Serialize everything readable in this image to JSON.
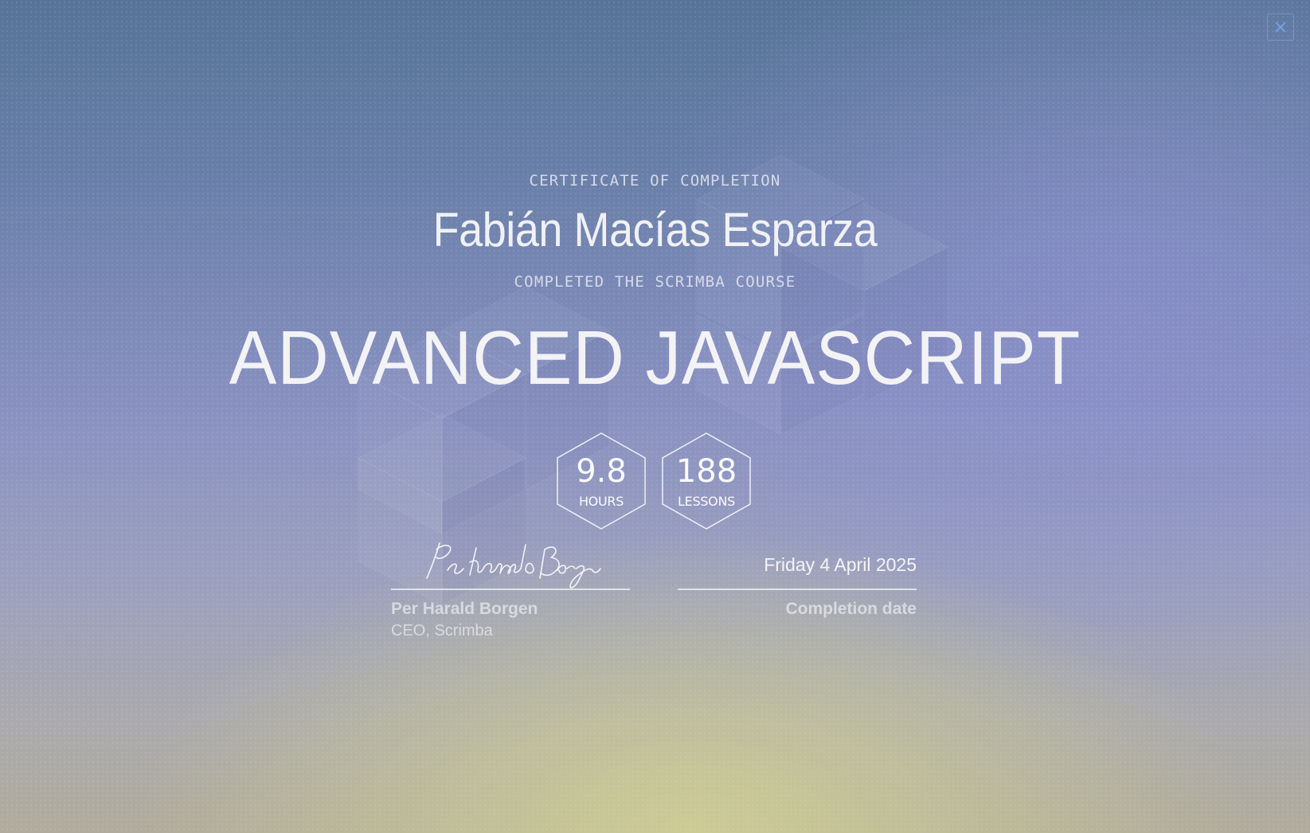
{
  "certificate": {
    "heading": "CERTIFICATE OF COMPLETION",
    "recipient_name": "Fabián Macías Esparza",
    "subheading": "COMPLETED THE SCRIMBA COURSE",
    "course_title": "ADVANCED JAVASCRIPT"
  },
  "stats": [
    {
      "value": "9.8",
      "unit": "HOURS"
    },
    {
      "value": "188",
      "unit": "LESSONS"
    }
  ],
  "signer": {
    "name": "Per Harald Borgen",
    "title": "CEO, Scrimba",
    "signature_text": "Per Harald Borgen"
  },
  "completion": {
    "date": "Friday 4 April 2025",
    "label": "Completion date"
  },
  "icons": {
    "close": "close-icon"
  }
}
